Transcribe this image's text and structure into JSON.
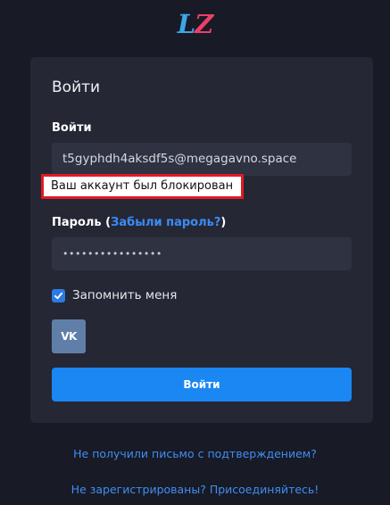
{
  "logo": {
    "first": "L",
    "second": "Z"
  },
  "card": {
    "title": "Войти",
    "login_label": "Войти",
    "email_value": "t5gyphdh4aksdf5s@megagavno.space",
    "error_message": "Ваш аккаунт был блокирован",
    "password_label_prefix": "Пароль (",
    "forgot_password_link": "Забыли пароль?",
    "password_label_suffix": ")",
    "password_value": "••••••••••••••••",
    "remember_label": "Запомнить меня",
    "remember_checked": true,
    "vk_label": "VK",
    "submit_label": "Войти"
  },
  "links": {
    "resend_confirmation": "Не получили письмо с подтверждением?",
    "register": "Не зарегистрированы? Присоединяйтесь!"
  },
  "colors": {
    "background": "#181a25",
    "card": "#252734",
    "accent": "#1a87f2",
    "error_border": "#e01b24",
    "link": "#3b8cf5"
  }
}
